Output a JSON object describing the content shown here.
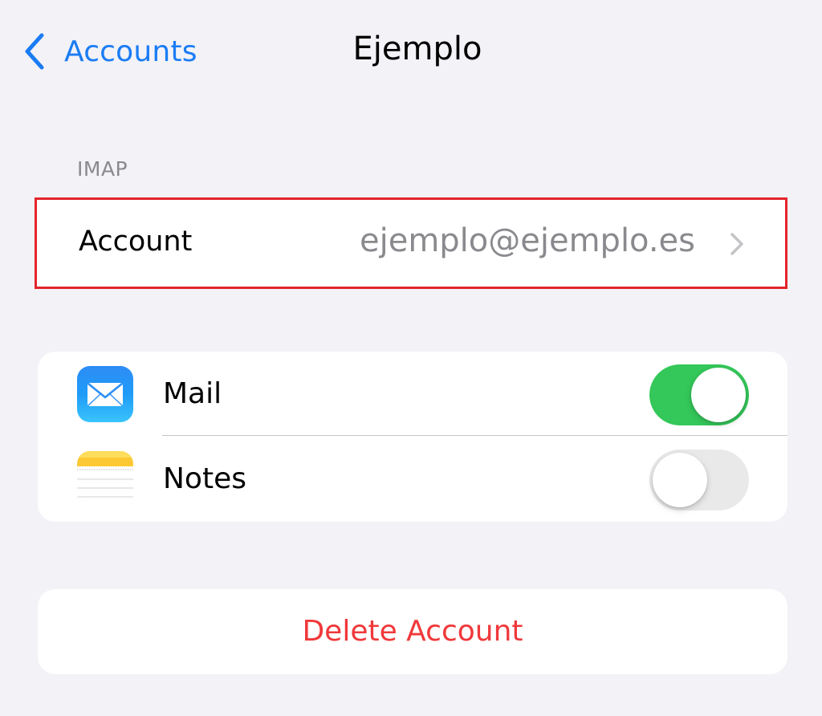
{
  "nav": {
    "back_label": "Accounts",
    "back_icon": "chevron-left-icon",
    "title": "Ejemplo"
  },
  "section": {
    "header": "IMAP"
  },
  "account": {
    "label": "Account",
    "value": "ejemplo@ejemplo.es",
    "chevron_icon": "chevron-right-icon",
    "highlight_color": "#e3242b"
  },
  "toggles": [
    {
      "label": "Mail",
      "icon": "mail-icon",
      "enabled": true
    },
    {
      "label": "Notes",
      "icon": "notes-icon",
      "enabled": false
    }
  ],
  "delete": {
    "label": "Delete Account",
    "color": "#f0383a"
  },
  "colors": {
    "accent": "#1a7cf4",
    "background": "#f2f2f7",
    "switch_on": "#34c759",
    "switch_off": "#e9e9ea",
    "secondary_text": "#8a8a8e"
  }
}
